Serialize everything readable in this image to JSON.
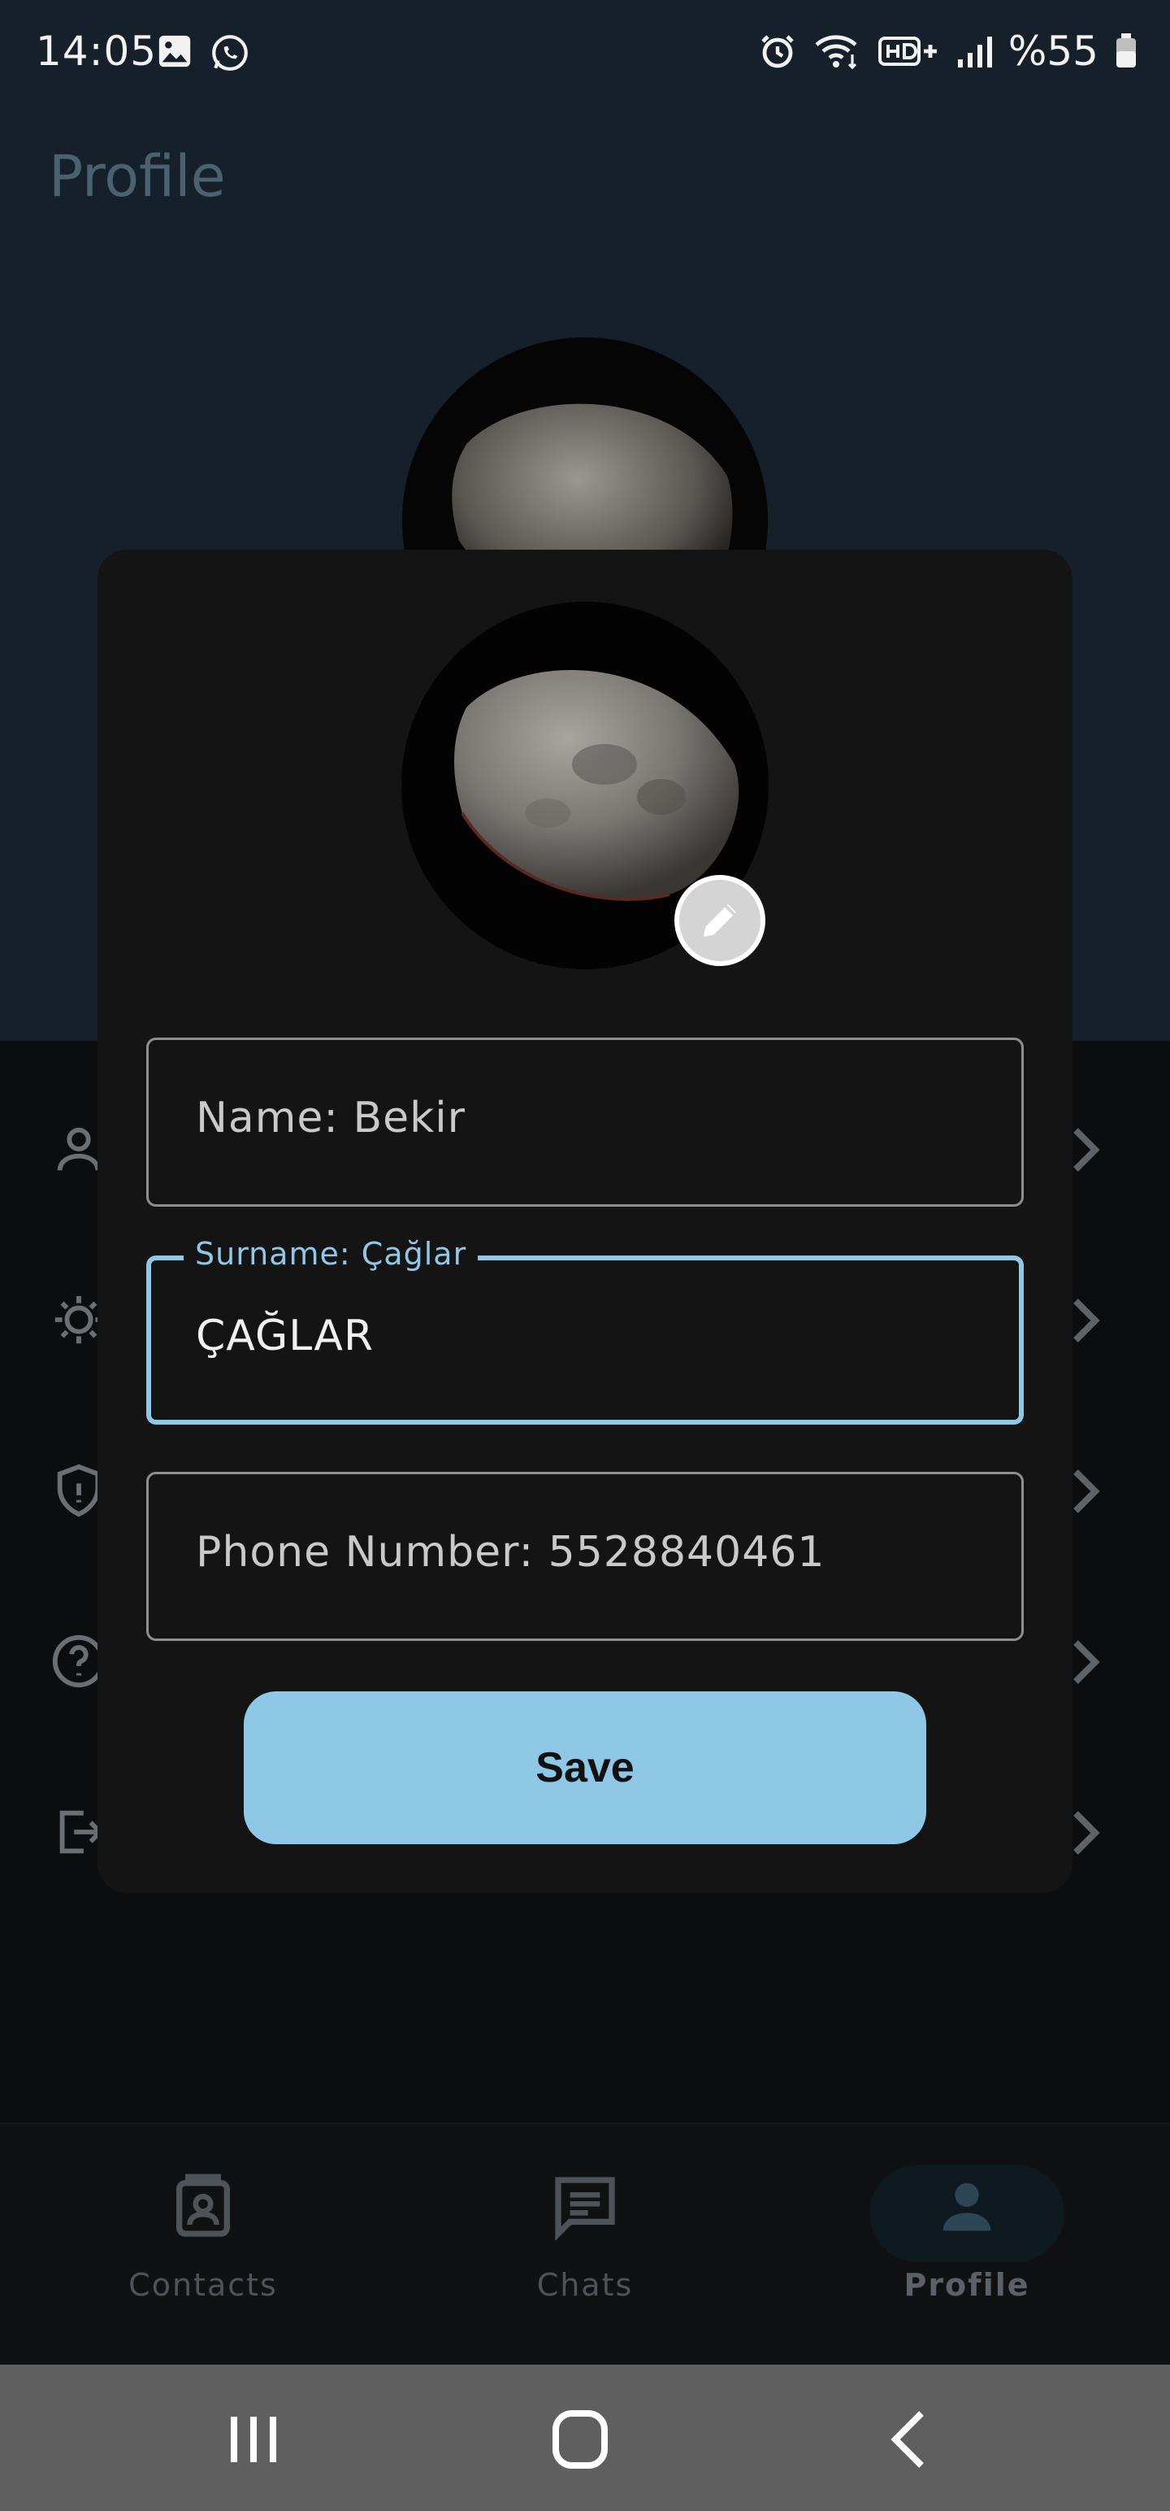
{
  "status_bar": {
    "time": "14:05",
    "battery": "%55",
    "left_icons": [
      "gallery-icon",
      "whatsapp-icon"
    ],
    "right_icons": [
      "alarm-icon",
      "wifi-icon",
      "hd-voice-icon",
      "signal-icon",
      "battery-icon"
    ]
  },
  "header": {
    "title": "Profile"
  },
  "menu": {
    "items": [
      {
        "icon": "person-icon"
      },
      {
        "icon": "theme-icon"
      },
      {
        "icon": "shield-icon"
      },
      {
        "icon": "help-icon"
      },
      {
        "icon": "logout-icon"
      }
    ]
  },
  "dialog": {
    "name_field": {
      "value": "Name: Bekir"
    },
    "surname_field": {
      "label": "Surname: Çağlar",
      "value": "ÇAĞLAR"
    },
    "phone_field": {
      "value": "Phone Number: 5528840461"
    },
    "save_label": "Save"
  },
  "bottom_nav": {
    "tabs": [
      {
        "label": "Contacts",
        "icon": "contacts-icon",
        "active": false
      },
      {
        "label": "Chats",
        "icon": "chat-icon",
        "active": false
      },
      {
        "label": "Profile",
        "icon": "profile-icon",
        "active": true
      }
    ]
  },
  "system_nav": [
    "recents-icon",
    "home-icon",
    "back-icon"
  ],
  "colors": {
    "accent": "#8ec8e6",
    "dialog_bg": "#141414",
    "page_bg": "#0b0c0d"
  }
}
